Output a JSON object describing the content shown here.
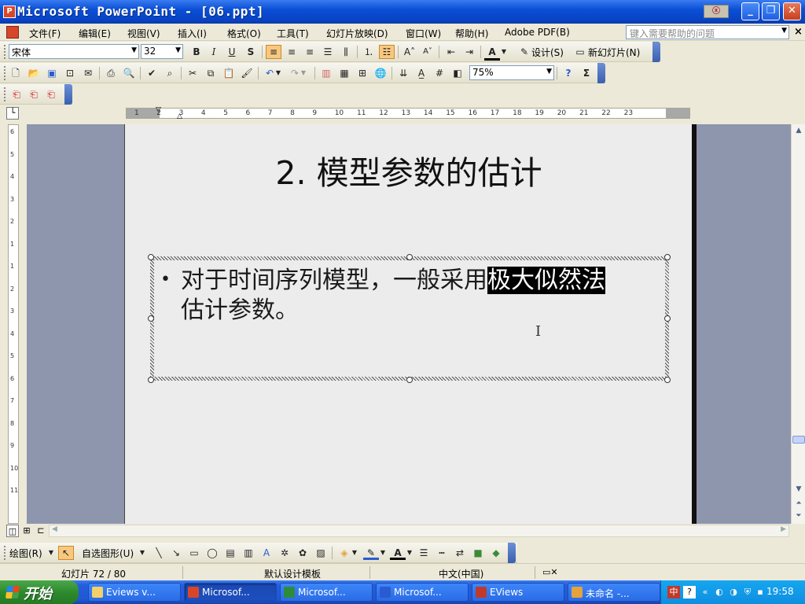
{
  "window": {
    "title": "Microsoft PowerPoint - [06.ppt]",
    "app_icon": "powerpoint-icon",
    "ime_indicator": "ⓧ"
  },
  "menubar": {
    "items": [
      "文件(F)",
      "编辑(E)",
      "视图(V)",
      "插入(I)",
      "格式(O)",
      "工具(T)",
      "幻灯片放映(D)",
      "窗口(W)",
      "帮助(H)",
      "Adobe PDF(B)"
    ],
    "help_placeholder": "键入需要帮助的问题"
  },
  "formatting_toolbar": {
    "font_name": "宋体",
    "font_size": "32",
    "design_label": "设计(S)",
    "new_slide_label": "新幻灯片(N)"
  },
  "standard_toolbar": {
    "zoom": "75%"
  },
  "ruler": {
    "h_ticks": [
      "1",
      "2",
      "3",
      "4",
      "5",
      "6",
      "7",
      "8",
      "9",
      "10",
      "11",
      "12",
      "13",
      "14",
      "15",
      "16",
      "17",
      "18",
      "19",
      "20",
      "21",
      "22",
      "23"
    ],
    "v_ticks": [
      "6",
      "5",
      "4",
      "3",
      "2",
      "1",
      "1",
      "2",
      "3",
      "4",
      "5",
      "6",
      "7",
      "8",
      "9",
      "10",
      "11"
    ]
  },
  "slide": {
    "title": "2. 模型参数的估计",
    "bullet_before": "对于时间序列模型，一般采用",
    "bullet_highlight": "极大似然法",
    "bullet_line2": "估计参数。"
  },
  "drawing_toolbar": {
    "draw_label": "绘图(R)",
    "autoshapes_label": "自选图形(U)"
  },
  "statusbar": {
    "slide_info": "幻灯片 72 / 80",
    "template": "默认设计模板",
    "language": "中文(中国)"
  },
  "taskbar": {
    "start_label": "开始",
    "tasks": [
      {
        "label": "Eviews v...",
        "icon": "folder-icon",
        "color": "#f3d06a"
      },
      {
        "label": "Microsof...",
        "icon": "powerpoint-icon",
        "color": "#d8462a",
        "active": true
      },
      {
        "label": "Microsof...",
        "icon": "excel-icon",
        "color": "#2e8b3a"
      },
      {
        "label": "Microsof...",
        "icon": "word-icon",
        "color": "#2a5bd0"
      },
      {
        "label": "EViews",
        "icon": "eviews-icon",
        "color": "#c0392b"
      },
      {
        "label": "未命名 -...",
        "icon": "paint-icon",
        "color": "#e6a23c"
      }
    ],
    "clock": "19:58"
  }
}
